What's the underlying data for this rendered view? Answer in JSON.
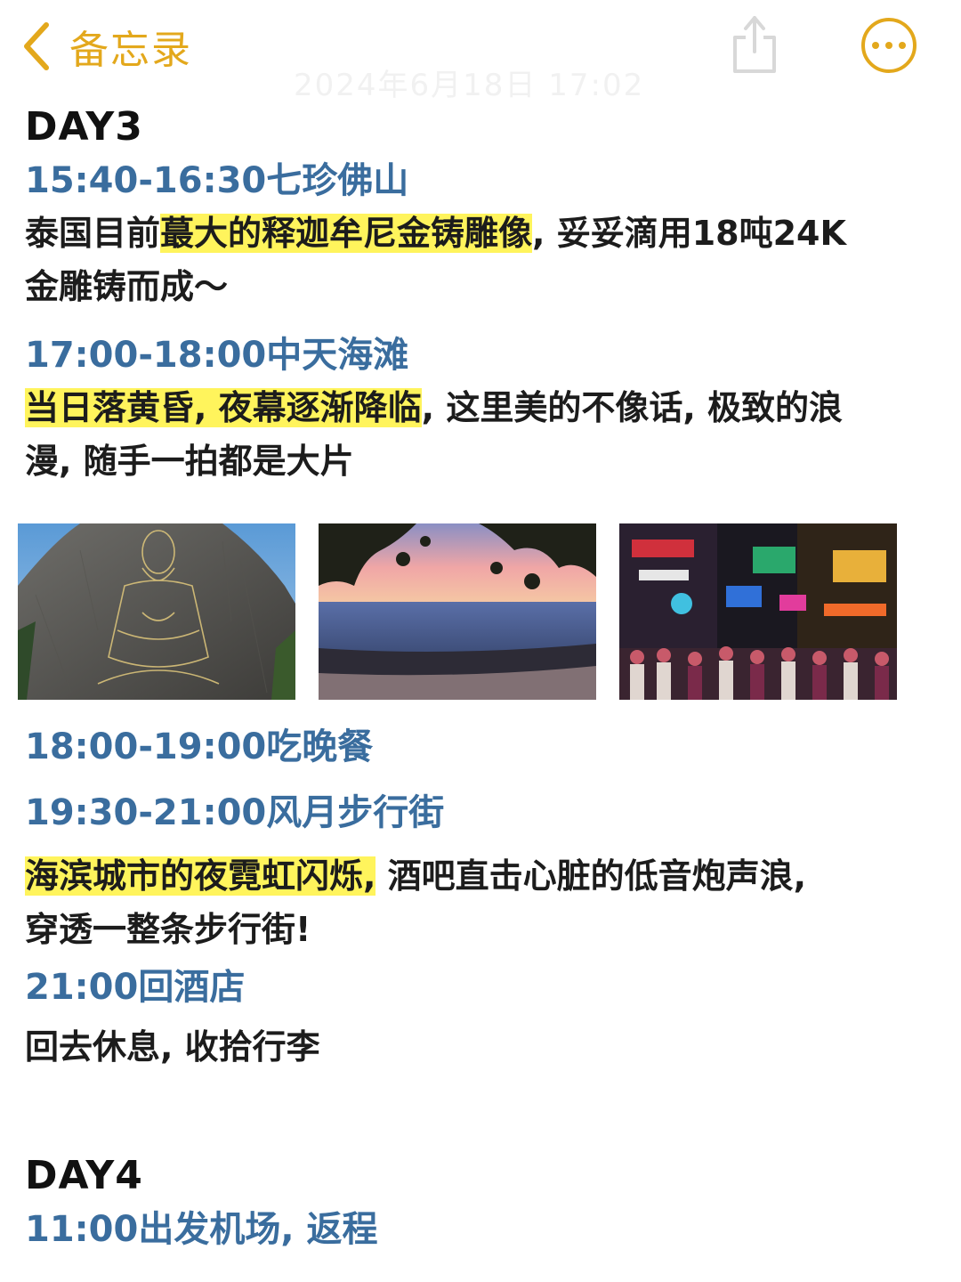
{
  "nav": {
    "back_label": "备忘录",
    "faded_date": "2024年6月18日 17:02"
  },
  "colors": {
    "accent": "#e3a81c",
    "time_blue": "#3a6d9e",
    "highlight": "#fff45c"
  },
  "icons": [
    "chevron-left-icon",
    "share-icon",
    "more-icon"
  ],
  "note": {
    "day3_title": "DAY3",
    "s1_time": "15:40-16:30七珍佛山",
    "s1_pre": "泰国目前",
    "s1_hl": "蕞大的释迦牟尼金铸雕像",
    "s1_post_line1": ", 妥妥滴用18吨24K",
    "s1_post_line2": "金雕铸而成～",
    "s2_time": "17:00-18:00中天海滩",
    "s2_hl": "当日落黄昏, 夜幕逐渐降临",
    "s2_post_line1": ", 这里美的不像话, 极致的浪",
    "s2_post_line2": "漫, 随手一拍都是大片",
    "photos": [
      "golden-buddha-cliff-photo",
      "sunset-beach-photo",
      "walking-street-night-photo"
    ],
    "s3_time": "18:00-19:00吃晚餐",
    "s4_time": "19:30-21:00风月步行街",
    "s4_hl": "海滨城市的夜霓虹闪烁,",
    "s4_post_line1": " 酒吧直击心脏的低音炮声浪,",
    "s4_post_line2": "穿透一整条步行街!",
    "s5_time": "21:00回酒店",
    "s5_desc": "回去休息, 收拾行李",
    "day4_title": "DAY4",
    "s6_time": "11:00出发机场, 返程"
  }
}
